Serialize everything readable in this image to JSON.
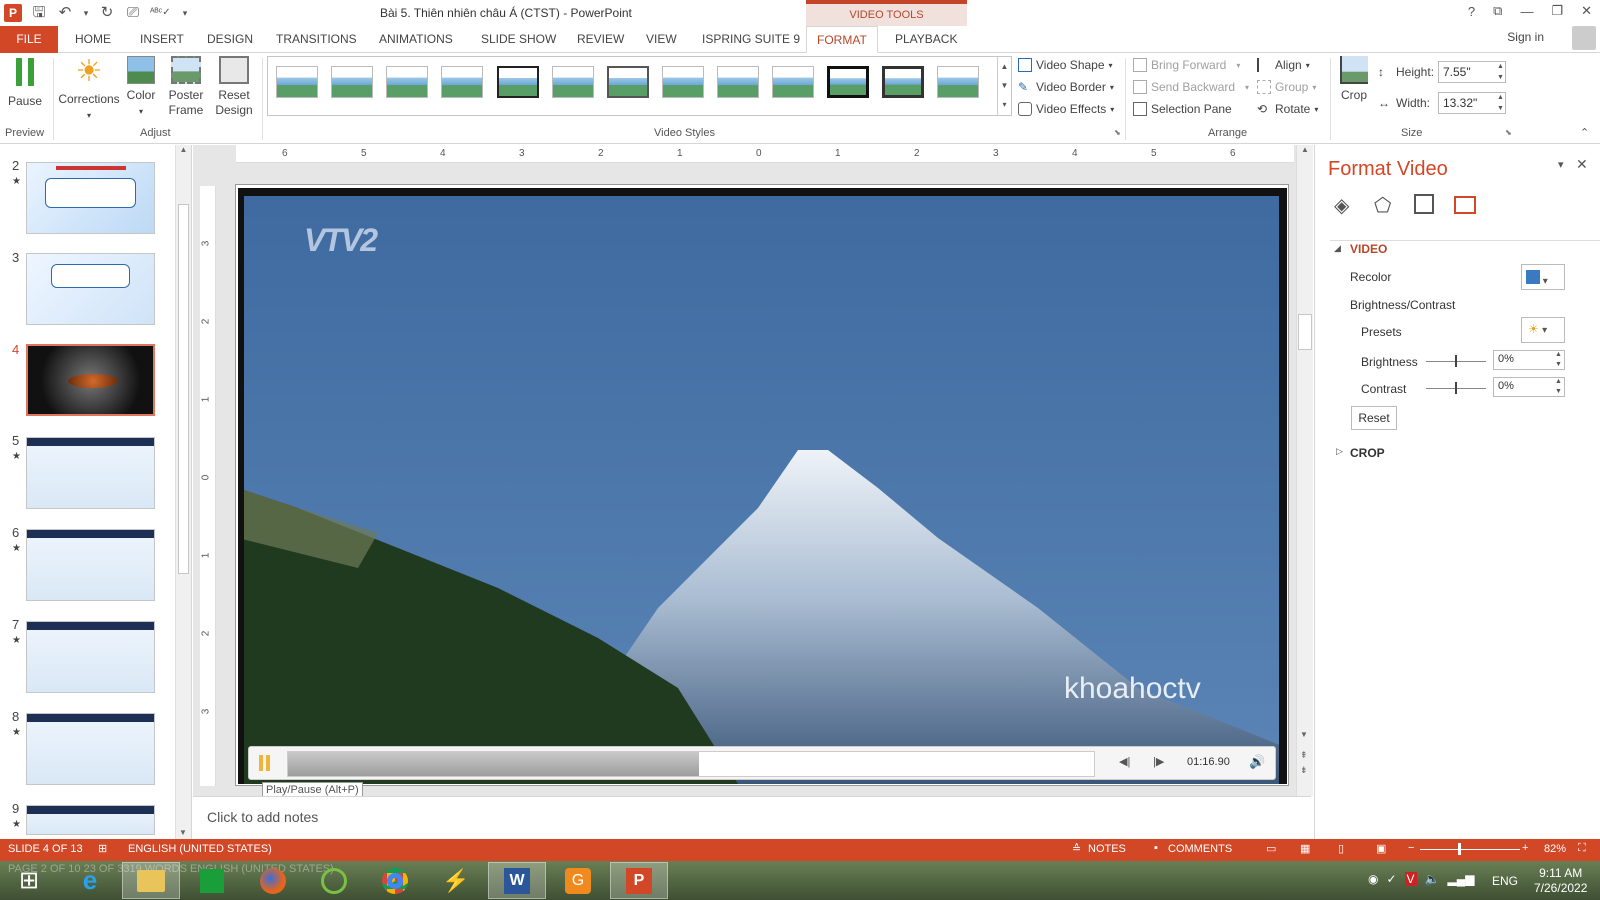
{
  "window": {
    "title": "Bài 5. Thiên nhiên châu Á (CTST) - PowerPoint",
    "context_tab": "VIDEO TOOLS",
    "help": "?",
    "sign_in": "Sign in"
  },
  "tabs": [
    "FILE",
    "HOME",
    "INSERT",
    "DESIGN",
    "TRANSITIONS",
    "ANIMATIONS",
    "SLIDE SHOW",
    "REVIEW",
    "VIEW",
    "ISPRING SUITE 9",
    "FORMAT",
    "PLAYBACK"
  ],
  "active_tab": "FORMAT",
  "ribbon": {
    "preview": {
      "group": "Preview",
      "pause": "Pause"
    },
    "adjust": {
      "group": "Adjust",
      "corrections": "Corrections",
      "color": "Color",
      "poster_frame": "Poster Frame",
      "reset_design": "Reset Design"
    },
    "video_styles": {
      "group": "Video Styles",
      "video_shape": "Video Shape",
      "video_border": "Video Border",
      "video_effects": "Video Effects"
    },
    "arrange": {
      "group": "Arrange",
      "bring_forward": "Bring Forward",
      "send_backward": "Send Backward",
      "selection_pane": "Selection Pane",
      "align": "Align",
      "group_btn": "Group",
      "rotate": "Rotate"
    },
    "size": {
      "group": "Size",
      "crop": "Crop",
      "height_label": "Height:",
      "height_value": "7.55\"",
      "width_label": "Width:",
      "width_value": "13.32\""
    }
  },
  "ruler": {
    "h_ticks": [
      "6",
      "5",
      "4",
      "3",
      "2",
      "1",
      "0",
      "1",
      "2",
      "3",
      "4",
      "5",
      "6"
    ],
    "v_ticks": [
      "3",
      "2",
      "1",
      "0",
      "1",
      "2",
      "3"
    ]
  },
  "slides": [
    {
      "num": "2",
      "star": "★",
      "selected": false
    },
    {
      "num": "3",
      "star": "",
      "selected": false
    },
    {
      "num": "4",
      "star": "",
      "selected": true
    },
    {
      "num": "5",
      "star": "★",
      "selected": false
    },
    {
      "num": "6",
      "star": "★",
      "selected": false
    },
    {
      "num": "7",
      "star": "★",
      "selected": false
    },
    {
      "num": "8",
      "star": "★",
      "selected": false
    },
    {
      "num": "9",
      "star": "★",
      "selected": false
    }
  ],
  "video": {
    "watermark_logo": "VTV2",
    "watermark_text": "khoahoctv",
    "time": "01:16.90",
    "progress": 0.51,
    "tooltip": "Play/Pause (Alt+P)"
  },
  "notes_placeholder": "Click to add notes",
  "format_pane": {
    "title": "Format Video",
    "section_video": "VIDEO",
    "recolor": "Recolor",
    "brightness_contrast": "Brightness/Contrast",
    "presets": "Presets",
    "brightness": "Brightness",
    "brightness_value": "0%",
    "contrast": "Contrast",
    "contrast_value": "0%",
    "reset": "Reset",
    "section_crop": "CROP"
  },
  "status": {
    "slide_info": "SLIDE 4 OF 13",
    "language": "ENGLISH (UNITED STATES)",
    "ghost_text": "PAGE 2 OF 10    23 OF 3319 WORDS    ENGLISH (UNITED STATES)",
    "notes": "NOTES",
    "comments": "COMMENTS",
    "zoom": "82%"
  },
  "taskbar": {
    "lang": "ENG",
    "time": "9:11 AM",
    "date": "7/26/2022"
  },
  "colors": {
    "accent": "#d24726",
    "tab_active": "#b7472a",
    "sky": "#3f6597"
  }
}
